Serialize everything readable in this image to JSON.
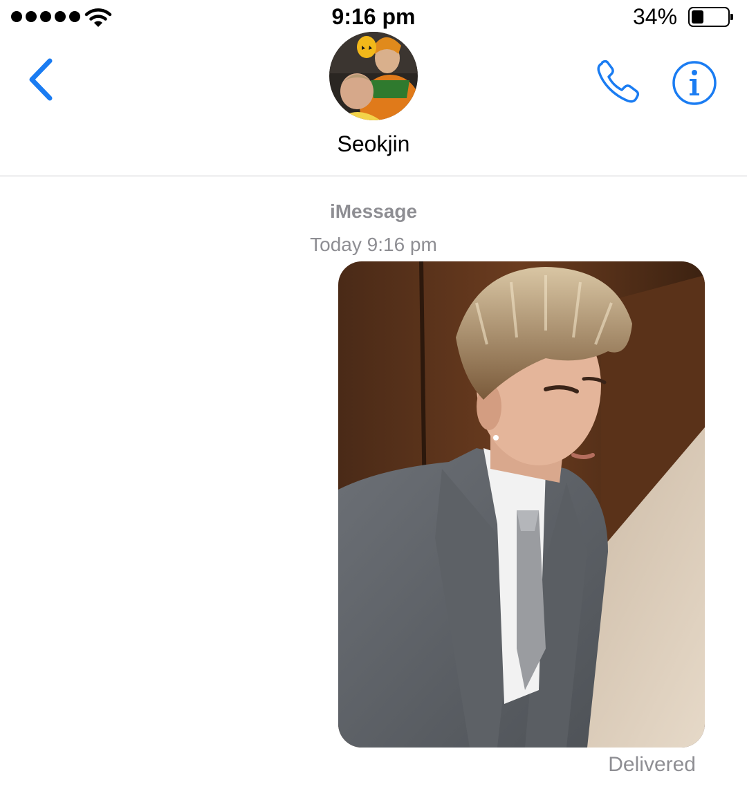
{
  "status_bar": {
    "time": "9:16 pm",
    "battery_percent_label": "34%",
    "battery_level": 0.34,
    "signal_bars": 5,
    "icons": [
      "signal-dots-icon",
      "wifi-icon",
      "battery-icon"
    ]
  },
  "header": {
    "contact_name": "Seokjin",
    "icons": [
      "chevron-left-icon",
      "phone-icon",
      "info-icon"
    ],
    "accent_color": "#1a7cf2"
  },
  "conversation": {
    "service_label": "iMessage",
    "timestamp": "Today 9:16 pm",
    "messages": [
      {
        "type": "photo",
        "direction": "outgoing",
        "status": "Delivered"
      }
    ]
  },
  "colors": {
    "secondary_text": "#8e8e93",
    "separator": "#c8c8cc"
  }
}
